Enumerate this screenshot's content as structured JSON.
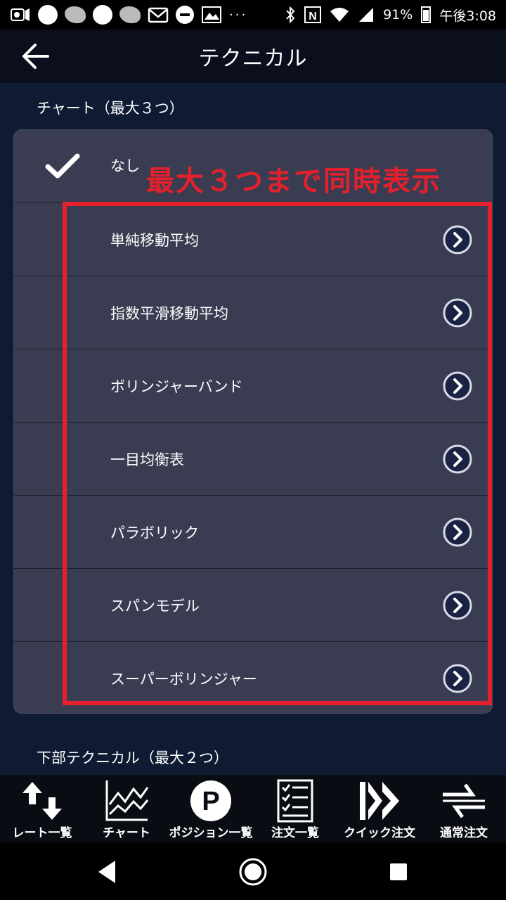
{
  "status_bar": {
    "icons": [
      "cast-icon",
      "circle-icon",
      "app-icon",
      "circle-icon",
      "app-icon",
      "gmail-icon",
      "dnd-icon",
      "photo-icon"
    ],
    "more": "···",
    "battery": "91%",
    "time": "午後3:08"
  },
  "app_bar": {
    "title": "テクニカル",
    "back_icon": "arrow-left-icon"
  },
  "chart_section": {
    "label": "チャート（最大３つ）",
    "items": [
      {
        "label": "なし",
        "selected": true
      },
      {
        "label": "単純移動平均",
        "selected": false
      },
      {
        "label": "指数平滑移動平均",
        "selected": false
      },
      {
        "label": "ボリンジャーバンド",
        "selected": false
      },
      {
        "label": "一目均衡表",
        "selected": false
      },
      {
        "label": "パラボリック",
        "selected": false
      },
      {
        "label": "スパンモデル",
        "selected": false
      },
      {
        "label": "スーパーボリンジャー",
        "selected": false
      }
    ]
  },
  "annotation": "最大３つまで同時表示",
  "lower_section": {
    "label": "下部テクニカル（最大２つ）"
  },
  "bottom_nav": [
    {
      "label": "レート一覧",
      "icon": "up-down-arrows-icon"
    },
    {
      "label": "チャート",
      "icon": "chart-icon"
    },
    {
      "label": "ポジション一覧",
      "icon": "position-p-icon"
    },
    {
      "label": "注文一覧",
      "icon": "order-list-icon"
    },
    {
      "label": "クイック注文",
      "icon": "quick-order-icon"
    },
    {
      "label": "通常注文",
      "icon": "normal-order-icon"
    }
  ],
  "colors": {
    "accent_red": "#e3202b",
    "card_bg": "#3a3d52",
    "page_bg": "#0f1b33"
  }
}
